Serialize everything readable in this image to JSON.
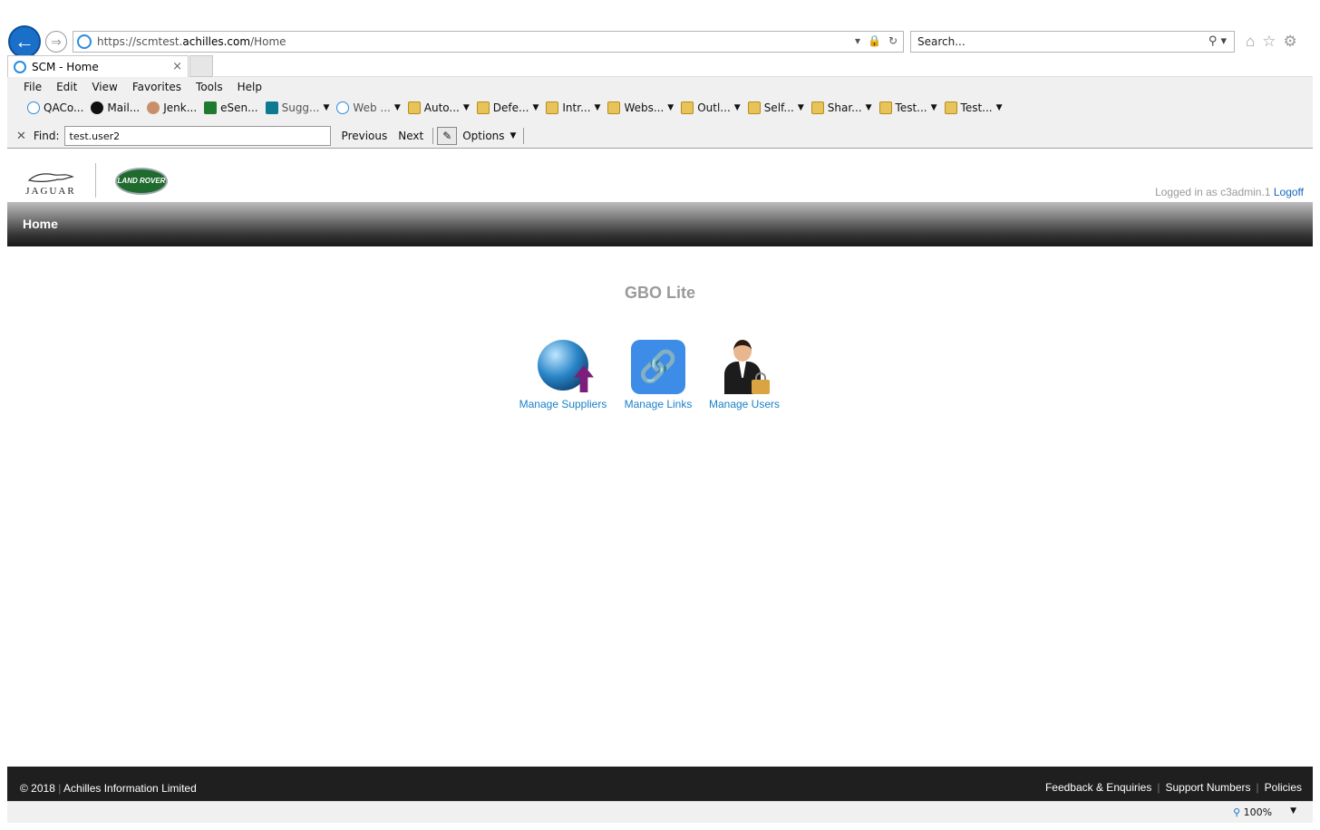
{
  "browser": {
    "url_scheme": "https://",
    "url_sub": "scmtest.",
    "url_host": "achilles.com",
    "url_path": "/Home",
    "search_placeholder": "Search...",
    "tab_title": "SCM - Home",
    "menu": [
      "File",
      "Edit",
      "View",
      "Favorites",
      "Tools",
      "Help"
    ],
    "favorites": [
      {
        "label": "QACo...",
        "icon": "ie-page-icon",
        "dropdown": false
      },
      {
        "label": "Mail...",
        "icon": "github-icon",
        "dropdown": false
      },
      {
        "label": "Jenk...",
        "icon": "jenkins-icon",
        "dropdown": false
      },
      {
        "label": "eSen...",
        "icon": "monitor-icon",
        "dropdown": false
      },
      {
        "label": "Sugg...",
        "icon": "bing-icon",
        "dropdown": true
      },
      {
        "label": "Web ...",
        "icon": "ie-page-icon",
        "dropdown": true
      },
      {
        "label": "Auto...",
        "icon": "folder-icon",
        "dropdown": true
      },
      {
        "label": "Defe...",
        "icon": "folder-icon",
        "dropdown": true
      },
      {
        "label": "Intr...",
        "icon": "folder-icon",
        "dropdown": true
      },
      {
        "label": "Webs...",
        "icon": "folder-icon",
        "dropdown": true
      },
      {
        "label": "Outl...",
        "icon": "folder-icon",
        "dropdown": true
      },
      {
        "label": "Self...",
        "icon": "folder-icon",
        "dropdown": true
      },
      {
        "label": "Shar...",
        "icon": "folder-icon",
        "dropdown": true
      },
      {
        "label": "Test...",
        "icon": "folder-icon",
        "dropdown": true
      },
      {
        "label": "Test...",
        "icon": "folder-icon",
        "dropdown": true
      }
    ],
    "find": {
      "label": "Find:",
      "value": "test.user2",
      "previous": "Previous",
      "next": "Next",
      "options": "Options"
    },
    "zoom": "100%"
  },
  "header": {
    "jaguar_logo_text": "JAGUAR",
    "landrover_logo_text": "LAND ROVER",
    "logged_in_text": "Logged in as c3admin.1",
    "logoff_label": "Logoff"
  },
  "nav": {
    "home_label": "Home"
  },
  "main": {
    "title": "GBO Lite",
    "tiles": [
      {
        "label": "Manage Suppliers",
        "icon": "globe-upload-icon"
      },
      {
        "label": "Manage Links",
        "icon": "link-icon"
      },
      {
        "label": "Manage Users",
        "icon": "user-lock-icon"
      }
    ]
  },
  "footer": {
    "copyright": "© 2018",
    "company": "Achilles Information Limited",
    "links": [
      "Feedback & Enquiries",
      "Support Numbers",
      "Policies"
    ]
  },
  "colors": {
    "link_blue": "#1a80c8",
    "title_gray": "#9a9a9a",
    "footer_bg": "#1f1f1f"
  }
}
